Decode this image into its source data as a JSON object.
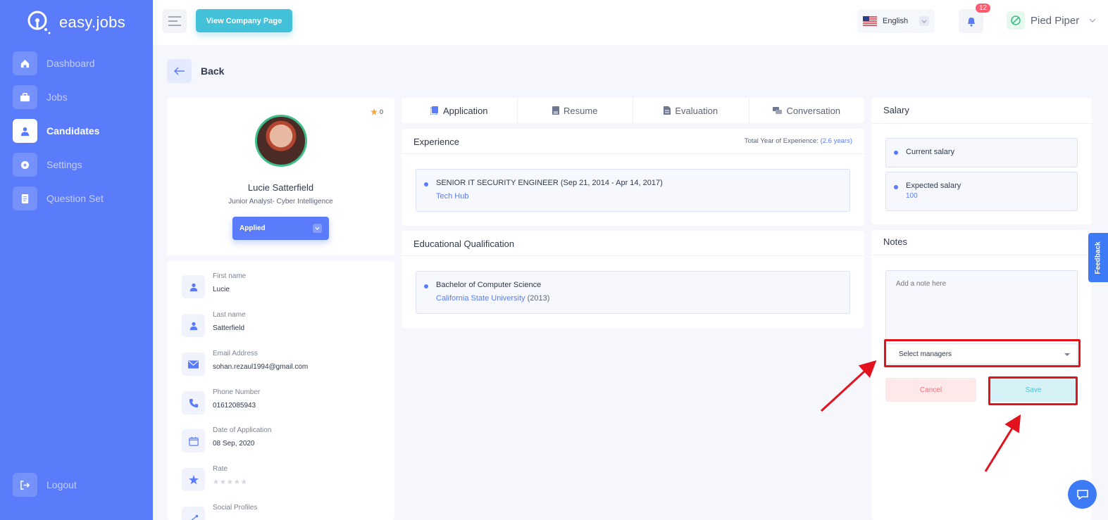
{
  "app": {
    "logo_text": "easy.jobs"
  },
  "sidebar": {
    "items": [
      {
        "label": "Dashboard",
        "icon": "home-icon",
        "active": false
      },
      {
        "label": "Jobs",
        "icon": "briefcase-icon",
        "active": false
      },
      {
        "label": "Candidates",
        "icon": "user-icon",
        "active": true
      },
      {
        "label": "Settings",
        "icon": "gear-icon",
        "active": false
      },
      {
        "label": "Question Set",
        "icon": "document-icon",
        "active": false
      }
    ],
    "logout_label": "Logout"
  },
  "topbar": {
    "view_company_label": "View Company Page",
    "language": "English",
    "notification_count": "12",
    "company_name": "Pied Piper"
  },
  "back_label": "Back",
  "candidate": {
    "rating_count": "0",
    "name": "Lucie Satterfield",
    "role": "Junior Analyst- Cyber Intelligence",
    "status": "Applied",
    "fields": [
      {
        "label": "First name",
        "value": "Lucie",
        "icon": "user-icon"
      },
      {
        "label": "Last name",
        "value": "Satterfield",
        "icon": "user-icon"
      },
      {
        "label": "Email Address",
        "value": "sohan.rezaul1994@gmail.com",
        "icon": "mail-icon"
      },
      {
        "label": "Phone Number",
        "value": "01612085943",
        "icon": "phone-icon"
      },
      {
        "label": "Date of Application",
        "value": "08 Sep, 2020",
        "icon": "calendar-icon"
      },
      {
        "label": "Rate",
        "value": "★★★★★",
        "icon": "star-icon"
      },
      {
        "label": "Social Profiles",
        "value": "",
        "icon": "share-icon"
      }
    ]
  },
  "tabs": [
    {
      "label": "Application",
      "icon": "application-icon",
      "active": true
    },
    {
      "label": "Resume",
      "icon": "resume-icon",
      "active": false
    },
    {
      "label": "Evaluation",
      "icon": "evaluation-icon",
      "active": false
    },
    {
      "label": "Conversation",
      "icon": "conversation-icon",
      "active": false
    }
  ],
  "experience": {
    "title": "Experience",
    "total_label": "Total Year of Experience:",
    "total_value": "(2.6 years)",
    "items": [
      {
        "title": "SENIOR IT SECURITY ENGINEER (Sep 21, 2014 - Apr 14, 2017)",
        "company": "Tech Hub"
      }
    ]
  },
  "education": {
    "title": "Educational Qualification",
    "items": [
      {
        "degree": "Bachelor of Computer Science",
        "institution": "California State University",
        "year": "(2013)"
      }
    ]
  },
  "salary": {
    "title": "Salary",
    "current_label": "Current salary",
    "current_value": "",
    "expected_label": "Expected salary",
    "expected_value": "100"
  },
  "notes": {
    "title": "Notes",
    "placeholder": "Add a note here",
    "managers_placeholder": "Select managers",
    "cancel_label": "Cancel",
    "save_label": "Save"
  },
  "feedback_label": "Feedback",
  "colors": {
    "primary": "#5b7cfa",
    "accent": "#43c1d8",
    "danger": "#ff6b7a",
    "annotation": "#e3131e"
  }
}
